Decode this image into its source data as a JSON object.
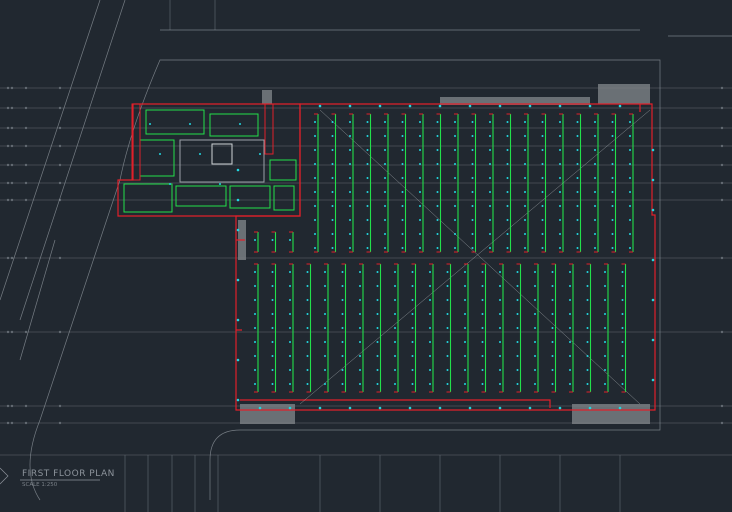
{
  "drawing": {
    "title": "FIRST FLOOR PLAN",
    "scale": "SCALE 1:250"
  },
  "colors": {
    "background": "#212830",
    "grid": "#9aa1a8",
    "wall": "#e0202a",
    "fixture_green": "#22e04a",
    "fixture_cyan": "#22d7e0",
    "stair_hatch": "#7d8287"
  }
}
